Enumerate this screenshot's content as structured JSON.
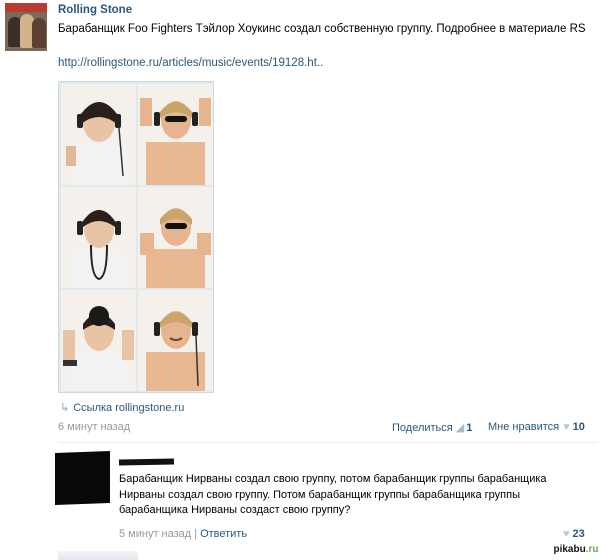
{
  "post": {
    "author": "Rolling Stone",
    "text": "Барабанщик Foo Fighters Тэйлор Хоукинс создал собственную группу. Подробнее в материале RS",
    "link": "http://rollingstone.ru/articles/music/events/19128.ht..",
    "attachment_link": "Ссылка rollingstone.ru",
    "time": "6 минут назад",
    "share_label": "Поделиться",
    "share_count": "1",
    "like_label": "Мне нравится",
    "like_count": "10"
  },
  "comment": {
    "text": "Барабанщик Нирваны создал свою группу, потом барабанщик группы барабанщика Нирваны создал свою группу. Потом барабанщик группы барабанщика группы барабанщика Нирваны создаст свою группу?",
    "time": "5 минут назад",
    "reply_label": "Ответить",
    "like_count": "23"
  },
  "watermark": {
    "part1": "pikabu",
    "part2": ".ru"
  },
  "colors": {
    "link": "#2b587a",
    "muted": "#999999",
    "photo_border": "#dfe9ee"
  },
  "icons": {
    "link": "link-arrow-icon",
    "share": "megaphone-icon",
    "like": "heart-icon"
  }
}
